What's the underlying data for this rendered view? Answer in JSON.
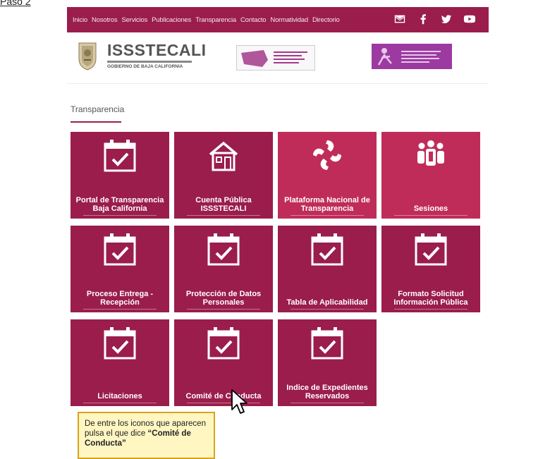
{
  "step_label": "Paso 2",
  "nav": {
    "links": [
      "Inicio",
      "Nosotros",
      "Servicios",
      "Publicaciones",
      "Transparencia",
      "Contacto",
      "Normatividad",
      "Directorio"
    ],
    "social_icons": [
      "mail-icon",
      "facebook-icon",
      "twitter-icon",
      "youtube-icon"
    ]
  },
  "header": {
    "logo_main": "ISSSTECALI",
    "logo_sub": "GOBIERNO DE BAJA CALIFORNIA"
  },
  "page": {
    "section_title": "Transparencia"
  },
  "tiles": [
    {
      "label": "Portal de Transparencia Baja California",
      "icon": "calendar-check-icon"
    },
    {
      "label": "Cuenta Pública ISSSTECALI",
      "icon": "house-icon"
    },
    {
      "label": "Plataforma Nacional de Transparencia",
      "icon": "pnt-logo-icon"
    },
    {
      "label": "Sesiones",
      "icon": "group-icon"
    },
    {
      "label": "Proceso Entrega - Recepción",
      "icon": "calendar-check-icon"
    },
    {
      "label": "Protección de Datos Personales",
      "icon": "calendar-check-icon"
    },
    {
      "label": "Tabla de Aplicabilidad",
      "icon": "calendar-check-icon"
    },
    {
      "label": "Formato Solicitud Información Pública",
      "icon": "calendar-check-icon"
    },
    {
      "label": "Licitaciones",
      "icon": "calendar-check-icon"
    },
    {
      "label": "Comité de Conducta",
      "icon": "calendar-check-icon"
    },
    {
      "label": "Indice de Expedientes Reservados",
      "icon": "calendar-check-icon"
    }
  ],
  "callout": {
    "text": "De entre los iconos que aparecen pulsa el que dice",
    "highlight": "“Comité de Conducta”"
  },
  "colors": {
    "primary": "#9a1d4c",
    "tile_alt": "#c02c5a",
    "callout_bg": "#fff6c2",
    "callout_border": "#d9a320"
  }
}
